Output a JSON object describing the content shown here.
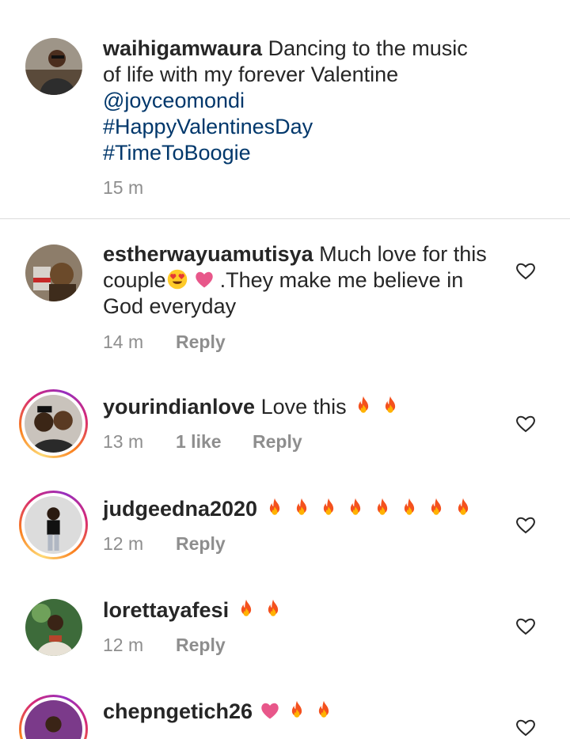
{
  "caption": {
    "username": "waihigamwaura",
    "text_line1": "Dancing to the music",
    "text_line2": "of life with my forever Valentine",
    "mention": "@joyceomondi",
    "tags": [
      "#HappyValentinesDay",
      "#TimeToBoogie"
    ],
    "time": "15 m"
  },
  "comments": [
    {
      "username": "estherwayuamutisya",
      "text_a": "Much love for this",
      "text_b": "couple",
      "text_c": ".They make me believe in",
      "text_d": "God everyday",
      "emojis": [
        "heart-eyes-emoji",
        "pink-heart-emoji"
      ],
      "time": "14 m",
      "reply": "Reply"
    },
    {
      "username": "yourindianlove",
      "text": "Love this",
      "emojis": [
        "fire-emoji",
        "fire-emoji"
      ],
      "time": "13 m",
      "likes": "1 like",
      "reply": "Reply"
    },
    {
      "username": "judgeedna2020",
      "emojis": [
        "fire-emoji",
        "fire-emoji",
        "fire-emoji",
        "fire-emoji",
        "fire-emoji",
        "fire-emoji",
        "fire-emoji",
        "fire-emoji"
      ],
      "time": "12 m",
      "reply": "Reply"
    },
    {
      "username": "lorettayafesi",
      "emojis": [
        "fire-emoji",
        "fire-emoji"
      ],
      "time": "12 m",
      "reply": "Reply"
    },
    {
      "username": "chepngetich26",
      "emojis": [
        "pink-heart-emoji",
        "fire-emoji",
        "fire-emoji"
      ]
    }
  ],
  "colors": {
    "text": "#262626",
    "secondary": "#8e8e8e",
    "link": "#00376b",
    "divider": "#dbdbdb"
  },
  "icons": {
    "like": "heart-outline-icon"
  }
}
